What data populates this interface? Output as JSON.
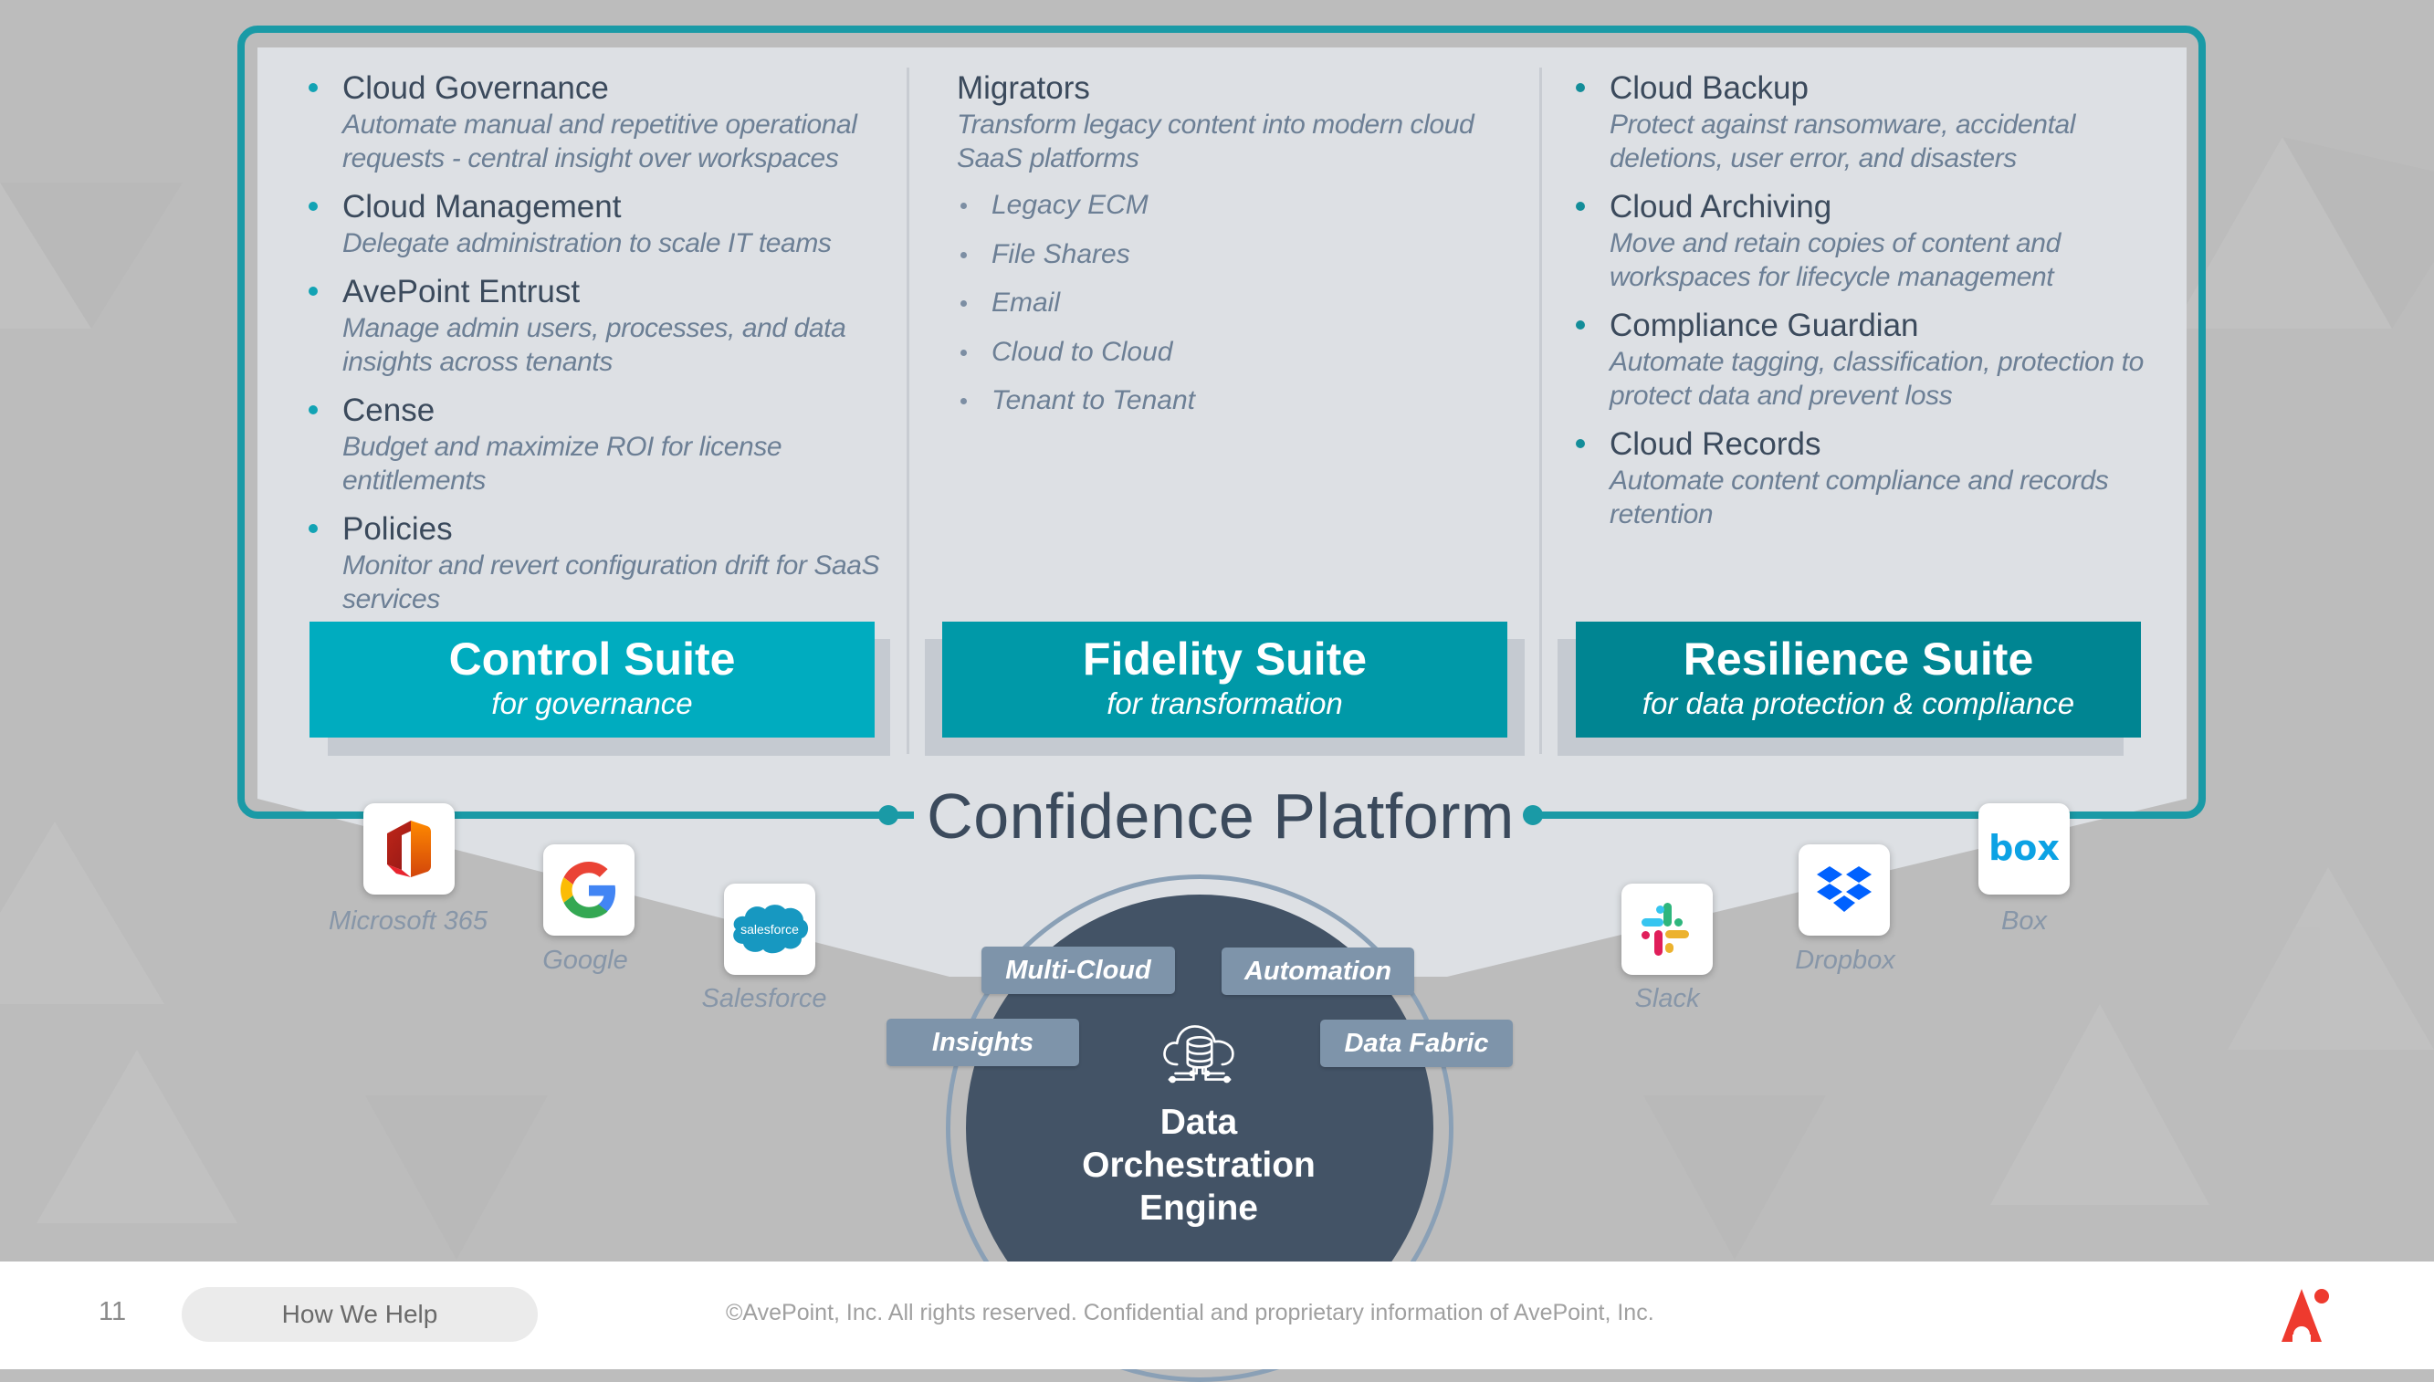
{
  "colors": {
    "frame_teal": "#1a9aa6",
    "control_suite": "#00acbf",
    "fidelity_suite": "#0099a8",
    "resilience_suite": "#008592",
    "engine_navy": "#435366",
    "tag_slate": "#7e94aa",
    "title_text": "#3b4a5c",
    "desc_text": "#6c7f95",
    "logo_red": "#ee3a2e"
  },
  "columns": [
    {
      "items": [
        {
          "title": "Cloud Governance",
          "desc": "Automate manual and repetitive operational requests - central insight over workspaces"
        },
        {
          "title": "Cloud Management",
          "desc": "Delegate administration to scale IT teams"
        },
        {
          "title": "AvePoint Entrust",
          "desc": "Manage admin users, processes, and data insights across tenants"
        },
        {
          "title": "Cense",
          "desc": "Budget and maximize ROI for license entitlements"
        },
        {
          "title": "Policies",
          "desc": "Monitor and revert configuration drift for SaaS services"
        }
      ]
    },
    {
      "title": "Migrators",
      "desc": "Transform legacy content into modern cloud SaaS platforms",
      "list": [
        "Legacy ECM",
        "File Shares",
        "Email",
        "Cloud to Cloud",
        "Tenant to Tenant"
      ]
    },
    {
      "items": [
        {
          "title": "Cloud Backup",
          "desc": "Protect against ransomware, accidental deletions, user error, and disasters"
        },
        {
          "title": "Cloud Archiving",
          "desc": "Move and retain copies of content and workspaces for lifecycle management"
        },
        {
          "title": "Compliance Guardian",
          "desc": "Automate tagging, classification, protection to protect data and prevent loss"
        },
        {
          "title": "Cloud Records",
          "desc": "Automate content compliance and records retention"
        }
      ]
    }
  ],
  "suites": [
    {
      "name": "Control Suite",
      "sub": "for governance"
    },
    {
      "name": "Fidelity Suite",
      "sub": "for transformation"
    },
    {
      "name": "Resilience Suite",
      "sub": "for data protection & compliance"
    }
  ],
  "platform_title": "Confidence Platform",
  "engine": {
    "line1": "Data",
    "line2": "Orchestration",
    "line3": "Engine",
    "icon": "cloud-database-icon",
    "tags": [
      "Multi-Cloud",
      "Automation",
      "Insights",
      "Data Fabric"
    ]
  },
  "apps_left": [
    {
      "name": "Microsoft 365",
      "icon": "microsoft-365-icon"
    },
    {
      "name": "Google",
      "icon": "google-icon"
    },
    {
      "name": "Salesforce",
      "icon": "salesforce-icon",
      "logo_text": "salesforce"
    }
  ],
  "apps_right": [
    {
      "name": "Slack",
      "icon": "slack-icon"
    },
    {
      "name": "Dropbox",
      "icon": "dropbox-icon"
    },
    {
      "name": "Box",
      "icon": "box-icon",
      "logo_text": "box"
    }
  ],
  "footer": {
    "page_number": "11",
    "section": "How We Help",
    "copyright": "©AvePoint, Inc. All rights reserved. Confidential and proprietary information of AvePoint, Inc.",
    "logo": "avepoint-logo"
  }
}
